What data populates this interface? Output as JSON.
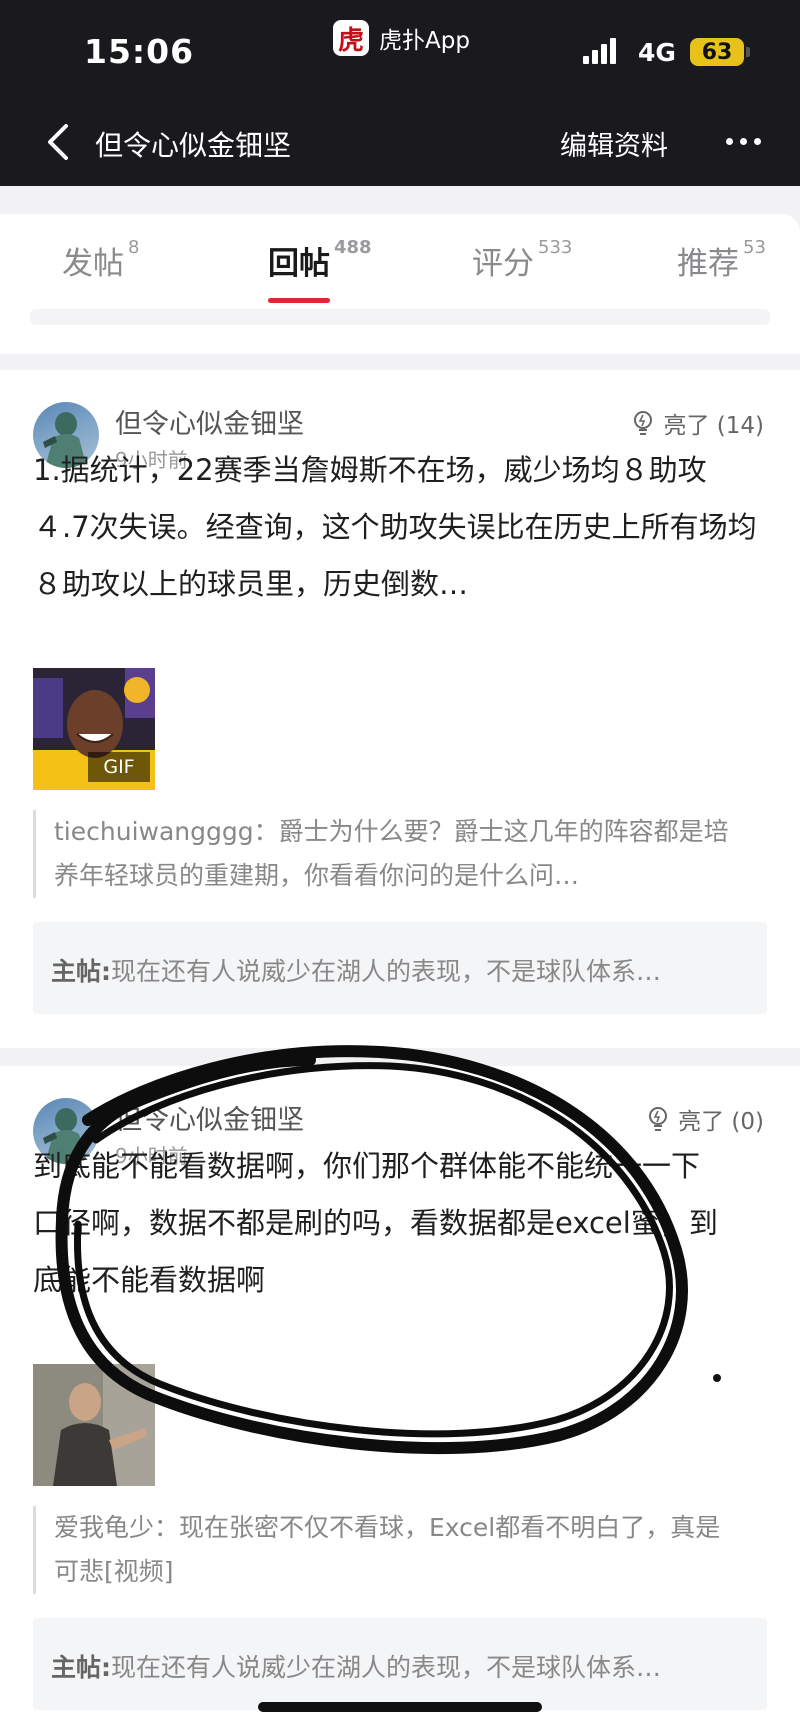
{
  "status_bar": {
    "time": "15:06",
    "app_name": "虎扑App",
    "app_logo_char": "虎",
    "network": "4G",
    "battery": "63"
  },
  "nav": {
    "title": "但令心似金钿坚",
    "edit_label": "编辑资料",
    "back_icon": "chevron-left-icon",
    "more_icon": "ellipsis-icon"
  },
  "tabs": [
    {
      "label": "发帖",
      "count": "8"
    },
    {
      "label": "回帖",
      "count": "488",
      "active": true
    },
    {
      "label": "评分",
      "count": "533"
    },
    {
      "label": "推荐",
      "count": "53"
    }
  ],
  "replies": [
    {
      "author": "但令心似金钿坚",
      "time": "9小时前",
      "light": "亮了 (14)",
      "text": "1.据统计，22赛季当詹姆斯不在场，威少场均８助攻４.7次失误。经查询，这个助攻失误比在历史上所有场均８助攻以上的球员里，历史倒数…",
      "image_badge": "GIF",
      "quote": "tiechuiwangggg：爵士为什么要？爵士这几年的阵容都是培养年轻球员的重建期，你看看你问的是什么问…",
      "main_post_label": "主帖:",
      "main_post_text": "现在还有人说威少在湖人的表现，不是球队体系…"
    },
    {
      "author": "但令心似金钿坚",
      "time": "9小时前",
      "light": "亮了 (0)",
      "text": "到底能不能看数据啊，你们那个群体能不能统一一下口径啊，数据不都是刷的吗，看数据都是excel蜜，到底能不能看数据啊",
      "quote": "爱我龟少：现在张密不仅不看球，Excel都看不明白了，真是可悲[视频]",
      "main_post_label": "主帖:",
      "main_post_text": "现在还有人说威少在湖人的表现，不是球队体系…"
    }
  ],
  "colors": {
    "accent_red": "#e02633",
    "topbar": "#1a1a1e",
    "battery": "#e7c21a"
  }
}
